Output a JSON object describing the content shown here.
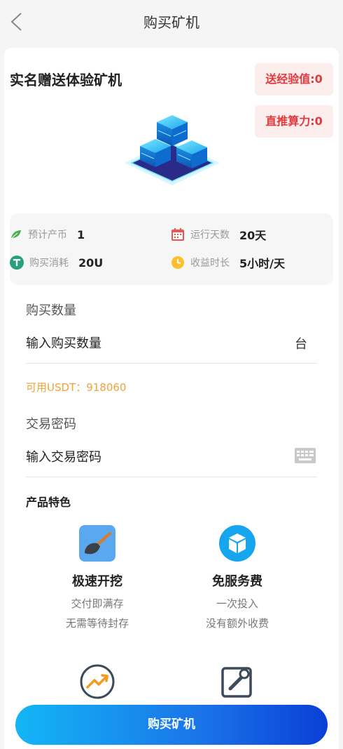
{
  "header": {
    "title": "购买矿机"
  },
  "promo": {
    "title": "实名赠送体验矿机",
    "badges": [
      "送经验值:0",
      "直推算力:0"
    ]
  },
  "stats": [
    {
      "icon": "leaf-icon",
      "label": "预计产币",
      "value": "1"
    },
    {
      "icon": "calendar-icon",
      "label": "运行天数",
      "value": "20天"
    },
    {
      "icon": "tether-icon",
      "label": "购买消耗",
      "value": "20U"
    },
    {
      "icon": "clock-icon",
      "label": "收益时长",
      "value": "5小时/天"
    }
  ],
  "form": {
    "quantity": {
      "label": "购买数量",
      "placeholder": "输入购买数量",
      "unit": "台"
    },
    "available": "可用USDT：918060",
    "password": {
      "label": "交易密码",
      "placeholder": "输入交易密码"
    }
  },
  "features": {
    "title": "产品特色",
    "items": [
      {
        "icon": "shovel-icon",
        "name": "极速开挖",
        "lines": [
          "交付即满存",
          "无需等待封存"
        ]
      },
      {
        "icon": "box-icon",
        "name": "免服务费",
        "lines": [
          "一次投入",
          "没有额外收费"
        ]
      },
      {
        "icon": "trend-chart-icon",
        "name": "",
        "lines": []
      },
      {
        "icon": "wrench-icon",
        "name": "",
        "lines": []
      }
    ]
  },
  "footer": {
    "buy_label": "购买矿机"
  },
  "colors": {
    "accent_start": "#13b6f5",
    "accent_end": "#0a3fd6",
    "badge_text": "#e4393c",
    "available_text": "#f0a23a"
  }
}
